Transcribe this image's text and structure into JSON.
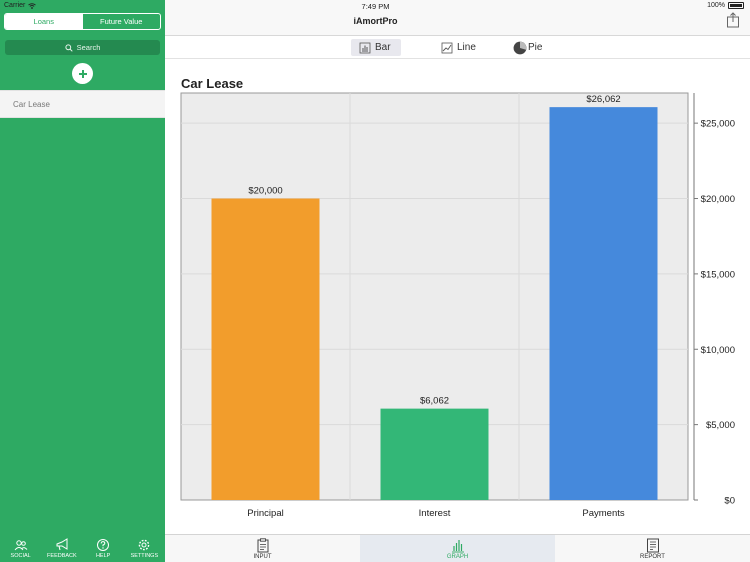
{
  "status": {
    "carrier": "Carrier",
    "time": "7:49 PM",
    "battery": "100%"
  },
  "sidebar": {
    "segments": [
      "Loans",
      "Future Value"
    ],
    "search_label": "Search",
    "loans": [
      "Car Lease"
    ],
    "tabs": [
      {
        "label": "SOCIAL",
        "icon": "people-icon"
      },
      {
        "label": "FEEDBACK",
        "icon": "megaphone-icon"
      },
      {
        "label": "HELP",
        "icon": "question-icon"
      },
      {
        "label": "SETTINGS",
        "icon": "gear-icon"
      }
    ]
  },
  "header": {
    "title": "iAmortPro"
  },
  "chart_types": [
    {
      "label": "Bar",
      "icon": "bar-chart-icon",
      "selected": true
    },
    {
      "label": "Line",
      "icon": "line-chart-icon",
      "selected": false
    },
    {
      "label": "Pie",
      "icon": "pie-chart-icon",
      "selected": false
    }
  ],
  "bottom_tabs": [
    {
      "label": "INPUT",
      "icon": "clipboard-icon",
      "active": false
    },
    {
      "label": "GRAPH",
      "icon": "graph-icon",
      "active": true
    },
    {
      "label": "REPORT",
      "icon": "report-icon",
      "active": false
    }
  ],
  "colors": {
    "brand_green": "#2eaa63",
    "principal": "#f29d2c",
    "interest": "#33b777",
    "payments": "#4589dc"
  },
  "chart_data": {
    "type": "bar",
    "title": "Car Lease",
    "categories": [
      "Principal",
      "Interest",
      "Payments"
    ],
    "values": [
      20000,
      6062,
      26062
    ],
    "data_labels": [
      "$20,000",
      "$6,062",
      "$26,062"
    ],
    "bar_colors": [
      "#f29d2c",
      "#33b777",
      "#4589dc"
    ],
    "ylim": [
      0,
      27000
    ],
    "y_ticks": [
      0,
      5000,
      10000,
      15000,
      20000,
      25000
    ],
    "y_tick_labels": [
      "$0",
      "$5,000",
      "$10,000",
      "$15,000",
      "$20,000",
      "$25,000"
    ],
    "y_axis_side": "right",
    "grid": true,
    "xlabel": "",
    "ylabel": ""
  }
}
